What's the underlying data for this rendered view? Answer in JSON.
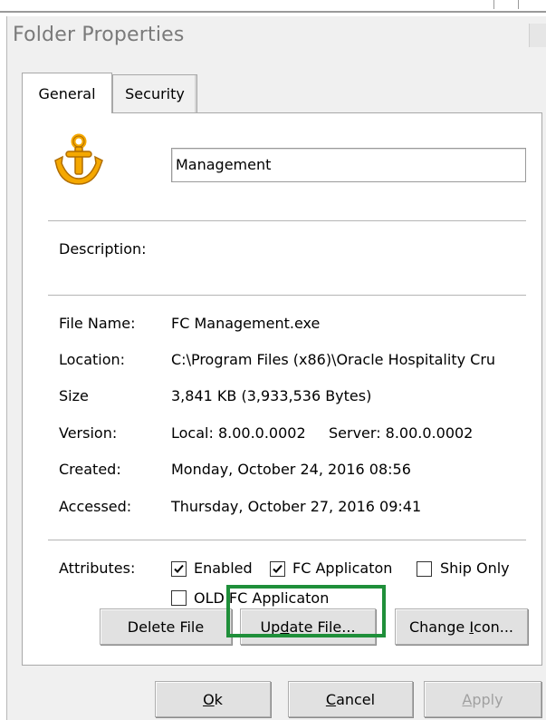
{
  "window": {
    "title": "Folder Properties"
  },
  "tabs": [
    {
      "label": "General"
    },
    {
      "label": "Security"
    }
  ],
  "name_field": {
    "value": "Management"
  },
  "description": {
    "label": "Description:"
  },
  "properties": [
    {
      "label": "File Name:",
      "value": "FC Management.exe"
    },
    {
      "label": "Location:",
      "value": "C:\\Program Files (x86)\\Oracle Hospitality Cru"
    },
    {
      "label": "Size",
      "value": "3,841 KB (3,933,536 Bytes)"
    },
    {
      "label": "Version:",
      "local": "Local: 8.00.0.0002",
      "server": "Server: 8.00.0.0002"
    },
    {
      "label": "Created:",
      "value": "Monday, October 24, 2016 08:56"
    },
    {
      "label": "Accessed:",
      "value": "Thursday, October 27, 2016 09:41"
    }
  ],
  "attributes": {
    "label": "Attributes:",
    "items": [
      {
        "label": "Enabled",
        "checked": true
      },
      {
        "label": "FC Applicaton",
        "checked": true
      },
      {
        "label": "Ship Only",
        "checked": false
      },
      {
        "label": "OLD FC Applicaton",
        "checked": false
      }
    ]
  },
  "file_buttons": {
    "delete": "Delete File",
    "update_pre": "Up",
    "update_key": "d",
    "update_post": "ate File...",
    "change_pre": "Change ",
    "change_key": "I",
    "change_post": "con..."
  },
  "dialog_buttons": {
    "ok_key": "O",
    "ok_post": "k",
    "cancel_key": "C",
    "cancel_post": "ancel",
    "apply_key": "A",
    "apply_post": "pply"
  },
  "colors": {
    "highlight": "#1f8f3a",
    "icon": "#f5a800"
  },
  "icons": {
    "app": "anchor-icon",
    "check": "checkmark-icon"
  }
}
